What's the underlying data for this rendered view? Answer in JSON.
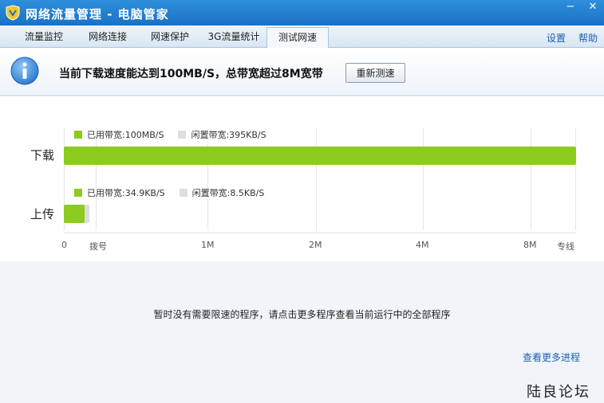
{
  "window": {
    "title": "网络流量管理 - 电脑管家",
    "minimize": "−",
    "close": "✕"
  },
  "tabs": [
    {
      "label": "流量监控"
    },
    {
      "label": "网络连接"
    },
    {
      "label": "网速保护"
    },
    {
      "label": "3G流量统计"
    },
    {
      "label": "测试网速",
      "active": true
    }
  ],
  "top_links": {
    "settings": "设置",
    "help": "帮助"
  },
  "info": {
    "message": "当前下载速度能达到100MB/S，总带宽超过8M宽带",
    "retest_button": "重新测速"
  },
  "speed_chart": {
    "download": {
      "label": "下载",
      "used_label": "已用带宽:",
      "used_value": "100MB/S",
      "idle_label": "闲置带宽:",
      "idle_value": "395KB/S",
      "fill_fraction": 1.0
    },
    "upload": {
      "label": "上传",
      "used_label": "已用带宽:",
      "used_value": "34.9KB/S",
      "idle_label": "闲置带宽:",
      "idle_value": "8.5KB/S",
      "fill_fraction": 0.04,
      "idle_fraction": 0.05
    },
    "ticks": [
      "0",
      "拨号",
      "1M",
      "2M",
      "4M",
      "8M",
      "专线"
    ]
  },
  "colors": {
    "used": "#8ccc1f",
    "idle": "#dedede",
    "accent": "#1a71c4",
    "link": "#1c5fb0"
  },
  "notice": "暂时没有需要限速的程序，请点击更多程序查看当前运行中的全部程序",
  "more_link": "查看更多进程",
  "watermark": "陆良论坛"
}
